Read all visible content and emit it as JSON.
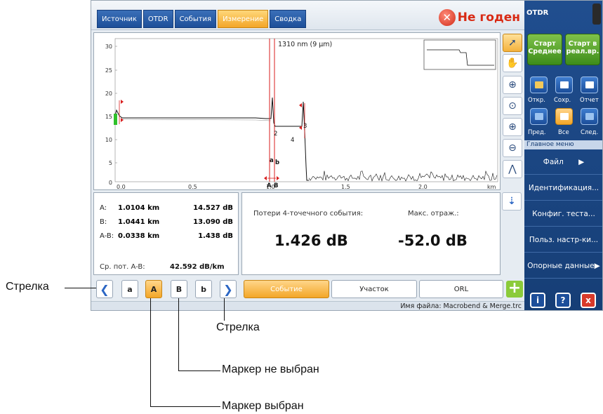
{
  "tabs": [
    {
      "label": "Источник"
    },
    {
      "label": "OTDR"
    },
    {
      "label": "События"
    },
    {
      "label": "Измерение"
    },
    {
      "label": "Сводка"
    }
  ],
  "status": {
    "text": "Не годен"
  },
  "graph": {
    "wavelength": "1310 nm (9 µm)",
    "y_ticks": [
      "30",
      "25",
      "20",
      "15",
      "10",
      "5",
      "0"
    ],
    "x_ticks": [
      "0.0",
      "0.5",
      "1.0",
      "1.5",
      "2.0"
    ],
    "x_unit": "km",
    "marker_labels": {
      "A": "A",
      "B": "B",
      "a": "a",
      "b": "b"
    },
    "event_labels": [
      "2",
      "4",
      "3"
    ]
  },
  "markers": {
    "A": {
      "label": "A:",
      "distance": "1.0104 km",
      "value": "14.527 dB"
    },
    "B": {
      "label": "B:",
      "distance": "1.0441 km",
      "value": "13.090 dB"
    },
    "AB": {
      "label": "A-B:",
      "distance": "0.0338 km",
      "value": "1.438 dB"
    },
    "avg_label": "Ср. пот. A-B:",
    "avg_value": "42.592 dB/km"
  },
  "measure": {
    "loss_label": "Потери 4-точечного события:",
    "loss_value": "1.426 dB",
    "refl_label": "Макс. отраж.:",
    "refl_value": "-52.0 dB"
  },
  "marker_buttons": {
    "left_arrow": "❮",
    "a": "a",
    "A": "A",
    "B": "B",
    "b": "b",
    "right_arrow": "❯"
  },
  "modes": {
    "event": "Событие",
    "section": "Участок",
    "orl": "ORL"
  },
  "filename": "Имя файла: Macrobend & Merge.trc",
  "right": {
    "title": "OTDR",
    "start_avg": "Старт Среднее",
    "start_rt": "Старт в реал.вр.",
    "open": "Откр.",
    "save": "Сохр.",
    "report": "Отчет",
    "prev": "Пред.",
    "all": "Все",
    "next": "След.",
    "menu_header": "Главное меню",
    "menu": [
      "Файл",
      "Идентификация...",
      "Конфиг. теста...",
      "Польз. настр-ки...",
      "Опорные данные"
    ],
    "info": "i",
    "help": "?",
    "close": "x"
  },
  "annotations": {
    "arrow_left": "Стрелка",
    "arrow_bottom": "Стрелка",
    "marker_unselected": "Маркер не выбран",
    "marker_selected": "Маркер выбран"
  },
  "chart_data": {
    "type": "line",
    "title": "1310 nm (9 µm)",
    "xlabel": "km",
    "ylabel": "",
    "xlim": [
      0,
      2.5
    ],
    "ylim": [
      0,
      32
    ],
    "x": [
      0.0,
      0.02,
      0.04,
      0.5,
      1.0,
      1.02,
      1.04,
      1.06,
      1.2,
      1.22,
      1.24,
      1.3,
      1.5,
      2.0,
      2.5
    ],
    "y": [
      15,
      16.5,
      15,
      14.9,
      14.8,
      17,
      13.5,
      12,
      12,
      16,
      10.5,
      0.5,
      0.8,
      0.6,
      0.4
    ]
  }
}
